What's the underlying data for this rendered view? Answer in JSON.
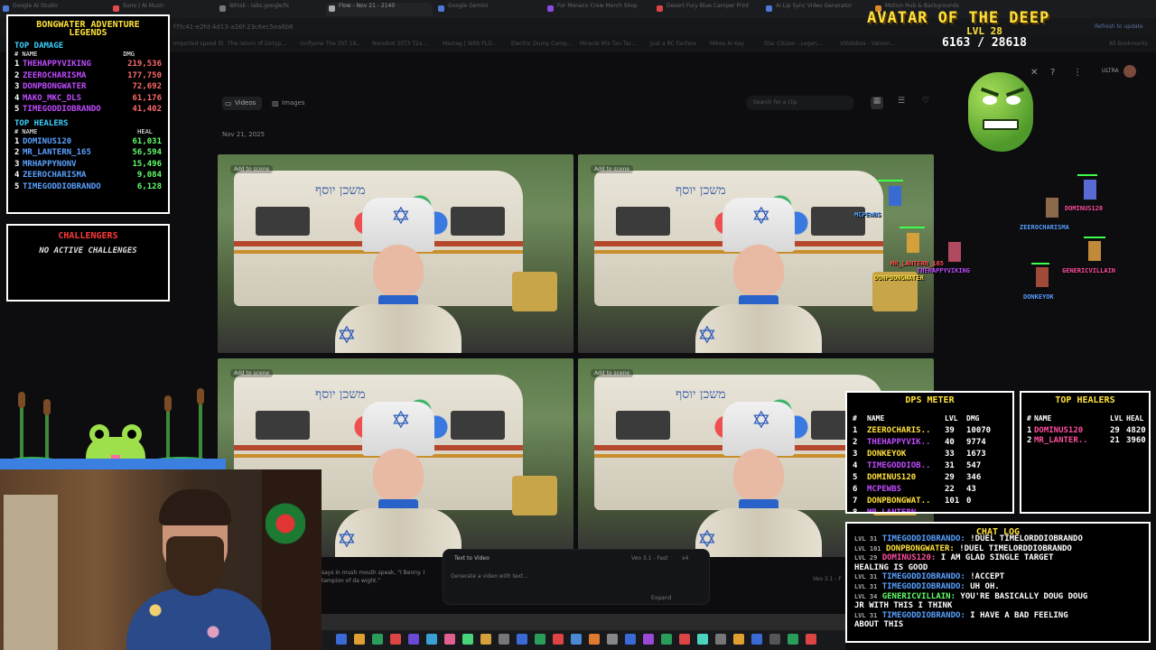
{
  "browser": {
    "tabs": [
      {
        "label": "Google AI Studio"
      },
      {
        "label": "Suno | AI Music"
      },
      {
        "label": "Whisk - labs.google/fx"
      },
      {
        "label": "Flow - Nov 21 - 2140"
      },
      {
        "label": "Google Gemini"
      },
      {
        "label": "For Monaco Crew Merch Shop"
      },
      {
        "label": "Desert Fury Blue Camper Print"
      },
      {
        "label": "AI Lip Sync Video Generator"
      },
      {
        "label": "Motion Hub & Backgrounds"
      }
    ],
    "url": "f7fc41-e2fd-4d13-a26f-23c6ec5ea6b6",
    "bookmarks": [
      "Imported speed 5t",
      "The return of Dirtyp...",
      "Unifyone The 3ST 18...",
      "Nanobot 3ST3 T2a...",
      "Mastag | With PLD...",
      "Electric Dump Camp...",
      "Miracle Mix Tan Tac...",
      "Just a RC Fanfare",
      "Mikoo Ai Kay",
      "Star Citizen - Legen...",
      "Villalobos - Vatoon...",
      "All Bookmarks"
    ],
    "update_label": "Refresh to update"
  },
  "app": {
    "filters": {
      "videos": "Videos",
      "images": "Images"
    },
    "date": "Nov 21, 2025",
    "search_placeholder": "Search for a clip",
    "add_to_scene": "Add to scene",
    "hebrew_sign": "משכן יוסף",
    "prompt": {
      "mode": "Text to Video",
      "placeholder": "Generate a video with text...",
      "model": "Veo 3.1 - Fast",
      "count": "x4",
      "expand": "Expand",
      "snippet": "says in mush mouth speak, \"I Benny. I tampion of da wight.\""
    },
    "veo_label": "Veo 3.1 - F",
    "ultra_label": "ULTRA"
  },
  "legends": {
    "title": "BONGWATER ADVENTURE LEGENDS",
    "damage_section": "TOP DAMAGE",
    "healers_section": "TOP HEALERS",
    "col_name": "# NAME",
    "col_dmg": "DMG",
    "col_heal": "HEAL",
    "damage": [
      {
        "rank": "1",
        "name": "THEHAPPYVIKING",
        "value": "219,536"
      },
      {
        "rank": "2",
        "name": "ZEEROCHARISMA",
        "value": "177,750"
      },
      {
        "rank": "3",
        "name": "DONPBONGWATER",
        "value": "72,692"
      },
      {
        "rank": "4",
        "name": "MAKO_MKC_DLS",
        "value": "61,176"
      },
      {
        "rank": "5",
        "name": "TIMEGODDIOBRANDO",
        "value": "41,402"
      }
    ],
    "healers": [
      {
        "rank": "1",
        "name": "DOMINUS120",
        "value": "61,031"
      },
      {
        "rank": "2",
        "name": "MR_LANTERN_165",
        "value": "56,594"
      },
      {
        "rank": "3",
        "name": "MRHAPPYNONV",
        "value": "15,496"
      },
      {
        "rank": "4",
        "name": "ZEEROCHARISMA",
        "value": "9,084"
      },
      {
        "rank": "5",
        "name": "TIMEGODDIOBRANDO",
        "value": "6,128"
      }
    ]
  },
  "challenges": {
    "title": "CHALLENGERS",
    "empty": "NO ACTIVE CHALLENGES"
  },
  "boss": {
    "name": "AVATAR OF THE DEEP",
    "level": "LVL 28",
    "hp": "6163 / 28618"
  },
  "characters": [
    {
      "name": "DOMINUS120",
      "color": "#ff4fa0"
    },
    {
      "name": "ZEEROCHARISMA",
      "color": "#5aa0ff"
    },
    {
      "name": "GENERICVILLAIN",
      "color": "#ff4fa0"
    },
    {
      "name": "DONKEYOK",
      "color": "#5aa0ff"
    },
    {
      "name": "THEHAPPYVIKING",
      "color": "#c04bff"
    },
    {
      "name": "DONPBONGWATER",
      "color": "#ffe23a"
    },
    {
      "name": "MR_LANTERN_165",
      "color": "#ff4f4f"
    },
    {
      "name": "MCPEWBS",
      "color": "#5aa0ff"
    }
  ],
  "dps_meter": {
    "title": "DPS METER",
    "headers": {
      "num": "#",
      "name": "NAME",
      "lvl": "LVL",
      "dmg": "DMG"
    },
    "rows": [
      {
        "num": "1",
        "name": "ZEEROCHARIS..",
        "lvl": "39",
        "dmg": "10070"
      },
      {
        "num": "2",
        "name": "THEHAPPYVIK..",
        "lvl": "40",
        "dmg": "9774"
      },
      {
        "num": "3",
        "name": "DONKEYOK",
        "lvl": "33",
        "dmg": "1673"
      },
      {
        "num": "4",
        "name": "TIMEGODDIOB..",
        "lvl": "31",
        "dmg": "547"
      },
      {
        "num": "5",
        "name": "DOMINUS120",
        "lvl": "29",
        "dmg": "346"
      },
      {
        "num": "6",
        "name": "MCPEWBS",
        "lvl": "22",
        "dmg": "43"
      },
      {
        "num": "7",
        "name": "DONPBONGWAT..",
        "lvl": "101",
        "dmg": "0"
      },
      {
        "num": "8",
        "name": "MR_LANTERN..",
        "lvl": "",
        "dmg": ""
      }
    ]
  },
  "top_healers": {
    "title": "TOP HEALERS",
    "headers": {
      "num": "#",
      "name": "NAME",
      "lvl": "LVL",
      "heal": "HEAL"
    },
    "rows": [
      {
        "num": "1",
        "name": "DOMINUS120",
        "lvl": "29",
        "heal": "4820"
      },
      {
        "num": "2",
        "name": "MR_LANTER..",
        "lvl": "21",
        "heal": "3960"
      }
    ]
  },
  "chat": {
    "title": "CHAT LOG",
    "lines": [
      {
        "lvl": "LVL 31",
        "user": "TIMEGODDIOBRANDO:",
        "msg": "!DUEL TIMELORDDIOBRANDO",
        "color": "#5aa0ff",
        "partial": "true"
      },
      {
        "lvl": "LVL 101",
        "user": "DONPBONGWATER:",
        "msg": "!DUEL TIMELORDDIOBRANDO",
        "color": "#ffe23a"
      },
      {
        "lvl": "LVL 29",
        "user": "DOMINUS120:",
        "msg": "I AM GLAD SINGLE TARGET",
        "color": "#ff4fa0"
      },
      {
        "lvl": "",
        "user": "",
        "msg": "HEALING IS GOOD",
        "color": "#ffffff"
      },
      {
        "lvl": "LVL 31",
        "user": "TIMEGODDIOBRANDO:",
        "msg": "!ACCEPT",
        "color": "#5aa0ff"
      },
      {
        "lvl": "LVL 31",
        "user": "TIMEGODDIOBRANDO:",
        "msg": "UH OH.",
        "color": "#5aa0ff"
      },
      {
        "lvl": "LVL 34",
        "user": "GENERICVILLAIN:",
        "msg": "YOU'RE BASICALLY DOUG DOUG",
        "color": "#62ff6a"
      },
      {
        "lvl": "",
        "user": "",
        "msg": "JR WITH THIS I THINK",
        "color": "#ffffff"
      },
      {
        "lvl": "LVL 31",
        "user": "TIMEGODDIOBRANDO:",
        "msg": "I HAVE A BAD FEELING",
        "color": "#5aa0ff"
      },
      {
        "lvl": "",
        "user": "",
        "msg": "ABOUT THIS",
        "color": "#ffffff"
      }
    ]
  },
  "colors": {
    "yellow": "#ffe23a",
    "purple_name": "#c04bff",
    "blue_name": "#5aa0ff",
    "dmg_red": "#ff6a6a",
    "heal_green": "#62ff6a",
    "challenge_red": "#ff3838",
    "section_cyan": "#3ad0ff"
  }
}
